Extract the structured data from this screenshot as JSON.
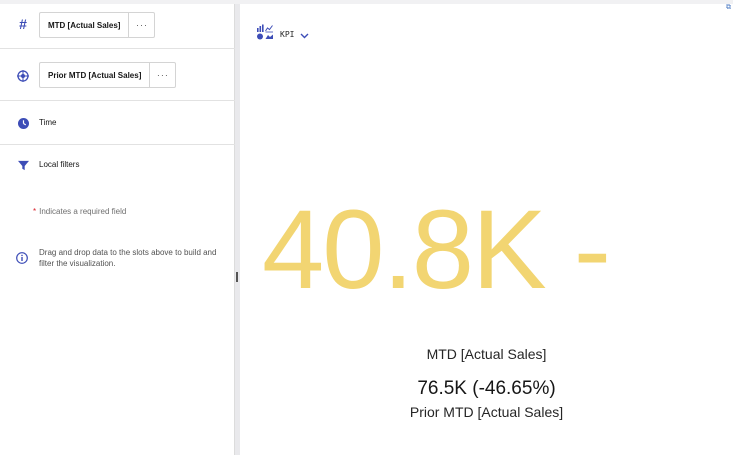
{
  "slots": {
    "value_slot": {
      "icon": "hash-icon",
      "label": "MTD [Actual Sales]",
      "more": "···"
    },
    "target_slot": {
      "icon": "target-icon",
      "label": "Prior MTD [Actual Sales]",
      "more": "···"
    },
    "time_slot": {
      "icon": "clock-icon",
      "label": "Time"
    },
    "local_filters": {
      "icon": "filter-icon",
      "label": "Local filters"
    }
  },
  "required_note": {
    "star": "*",
    "text": "Indicates a required field"
  },
  "info": {
    "icon": "info-icon",
    "text": "Drag and drop data to the slots above to build and filter the visualization."
  },
  "viz_switcher": {
    "icon": "chart-types-icon",
    "label": "KPI",
    "chevron": "chevron-down-icon"
  },
  "kpi": {
    "value": "40.8K -",
    "value_label": "MTD [Actual Sales]",
    "comparison": "76.5K (-46.65%)",
    "comparison_label": "Prior MTD [Actual Sales]"
  },
  "colors": {
    "kpi_value": "#f2d572",
    "accent": "#3d4db7",
    "required_star": "#da1e28"
  }
}
